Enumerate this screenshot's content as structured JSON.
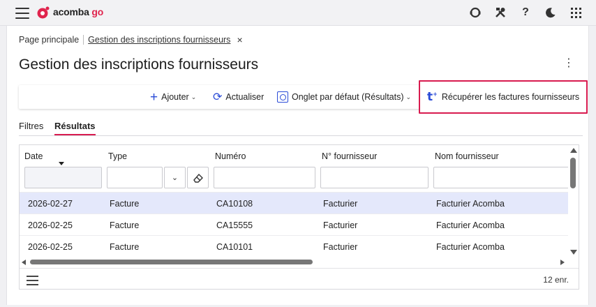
{
  "app": {
    "logo_text": "acomba",
    "logo_suffix": "go",
    "brand_color": "#e0244d"
  },
  "top_icons": [
    "support-icon",
    "tools-icon",
    "help-icon",
    "dark-mode-icon",
    "apps-grid-icon"
  ],
  "top_icon_glyphs": {
    "help": "?"
  },
  "breadcrumb": {
    "home": "Page principale",
    "current": "Gestion des inscriptions fournisseurs",
    "close": "×"
  },
  "page": {
    "title": "Gestion des inscriptions fournisseurs",
    "menu": "⋮"
  },
  "toolbar": {
    "add_label": "Ajouter",
    "refresh_label": "Actualiser",
    "tab_label": "Onglet par défaut (Résultats)",
    "fetch_label": "Récupérer les factures fournisseurs"
  },
  "tabs": [
    {
      "label": "Filtres",
      "active": false
    },
    {
      "label": "Résultats",
      "active": true
    }
  ],
  "grid": {
    "columns": [
      "Date",
      "Type",
      "Numéro",
      "N° fournisseur",
      "Nom fournisseur"
    ],
    "rows": [
      [
        "2026-02-27",
        "Facture",
        "CA10108",
        "Facturier",
        "Facturier Acomba"
      ],
      [
        "2026-02-25",
        "Facture",
        "CA15555",
        "Facturier",
        "Facturier Acomba"
      ],
      [
        "2026-02-25",
        "Facture",
        "CA10101",
        "Facturier",
        "Facturier Acomba"
      ]
    ],
    "selected_row": 0,
    "record_count": "12 enr."
  },
  "colors": {
    "accent_blue": "#2a4bd7",
    "highlight_pink": "#d81b4f",
    "selected_row": "#e4e8fb"
  }
}
